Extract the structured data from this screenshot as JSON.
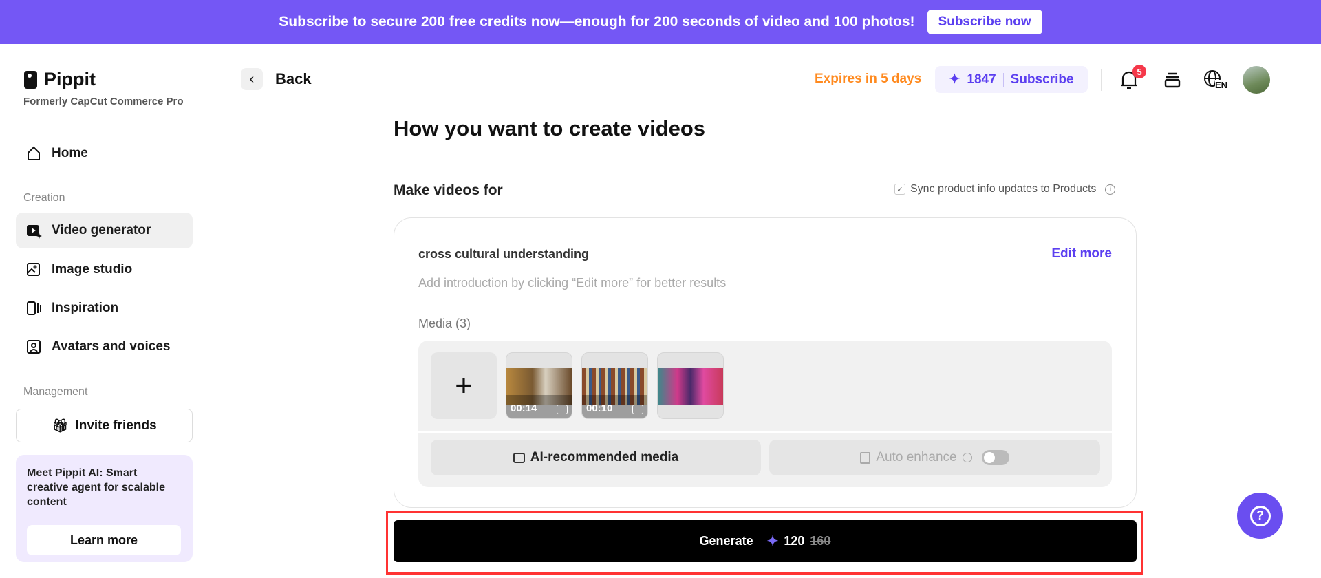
{
  "banner": {
    "text": "Subscribe to secure 200 free credits now—enough for 200 seconds of video and 100 photos!",
    "button": "Subscribe now"
  },
  "brand": {
    "name": "Pippit",
    "subtitle": "Formerly CapCut Commerce Pro"
  },
  "sidebar": {
    "home": "Home",
    "creation_label": "Creation",
    "items": [
      {
        "label": "Video generator",
        "icon": "video-icon"
      },
      {
        "label": "Image studio",
        "icon": "image-icon"
      },
      {
        "label": "Inspiration",
        "icon": "inspiration-icon"
      },
      {
        "label": "Avatars and voices",
        "icon": "avatar-icon"
      }
    ],
    "management_label": "Management",
    "invite": "Invite friends",
    "promo": {
      "bold": "Meet Pippit AI:",
      "text": " Smart creative agent for scalable content",
      "button": "Learn more"
    }
  },
  "header": {
    "back": "Back",
    "expires": "Expires in 5 days",
    "credits": "1847",
    "subscribe": "Subscribe",
    "notifications": "5",
    "language": "EN"
  },
  "main": {
    "title": "How you want to create videos",
    "make_for": "Make videos for",
    "sync": "Sync product info updates to Products",
    "product_name": "cross cultural understanding",
    "edit_more": "Edit more",
    "intro_placeholder": "Add introduction by clicking “Edit more” for better results",
    "media_label": "Media (3)",
    "media": [
      {
        "duration": "00:14"
      },
      {
        "duration": "00:10"
      },
      {
        "duration": ""
      }
    ],
    "ai_media": "AI-recommended media",
    "auto_enhance": "Auto enhance",
    "auto_enhance_on": false,
    "generate": "Generate",
    "cost": "120",
    "original_cost": "160"
  },
  "colors": {
    "accent": "#7457f5",
    "expires": "#ff8a1f",
    "badge": "#f5384a"
  }
}
